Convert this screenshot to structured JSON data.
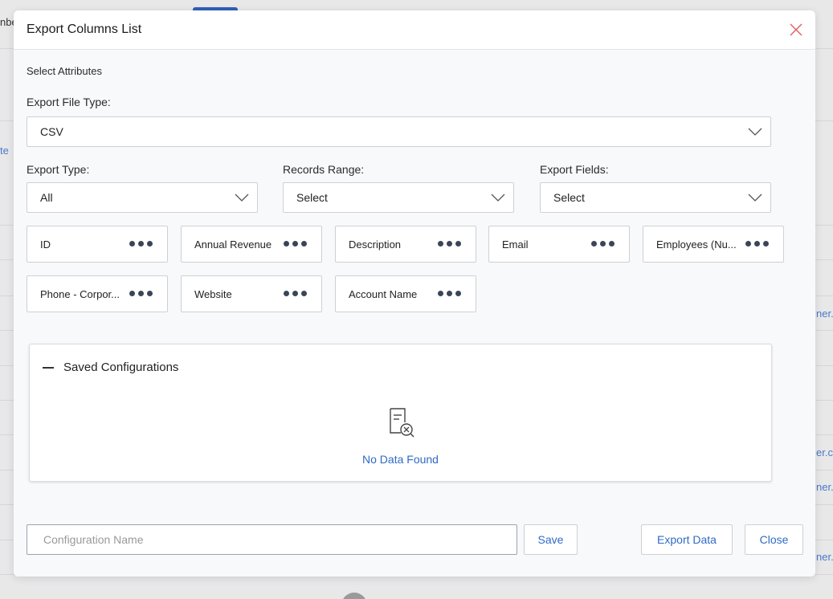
{
  "background": {
    "fragments": [
      "nbe",
      "te",
      "ner.",
      "er.c",
      "ner.",
      "ner."
    ]
  },
  "modal": {
    "title": "Export Columns List",
    "close_icon": "close-icon",
    "section_title": "Select Attributes",
    "file_type": {
      "label": "Export File Type:",
      "value": "CSV"
    },
    "export_type": {
      "label": "Export Type:",
      "value": "All"
    },
    "records_range": {
      "label": "Records Range:",
      "value": "Select"
    },
    "export_fields": {
      "label": "Export Fields:",
      "value": "Select"
    },
    "attributes": [
      "ID",
      "Annual Revenue",
      "Description",
      "Email",
      "Employees (Nu...",
      "Phone - Corpor...",
      "Website",
      "Account Name"
    ],
    "saved_configurations": {
      "title": "Saved Configurations",
      "empty_icon": "no-data-icon",
      "empty_text": "No Data Found"
    },
    "footer": {
      "config_placeholder": "Configuration Name",
      "save_label": "Save",
      "export_label": "Export Data",
      "close_label": "Close"
    }
  },
  "colors": {
    "accent": "#2f6bc4",
    "close_icon": "#e06060",
    "border": "#cdd0d5"
  }
}
